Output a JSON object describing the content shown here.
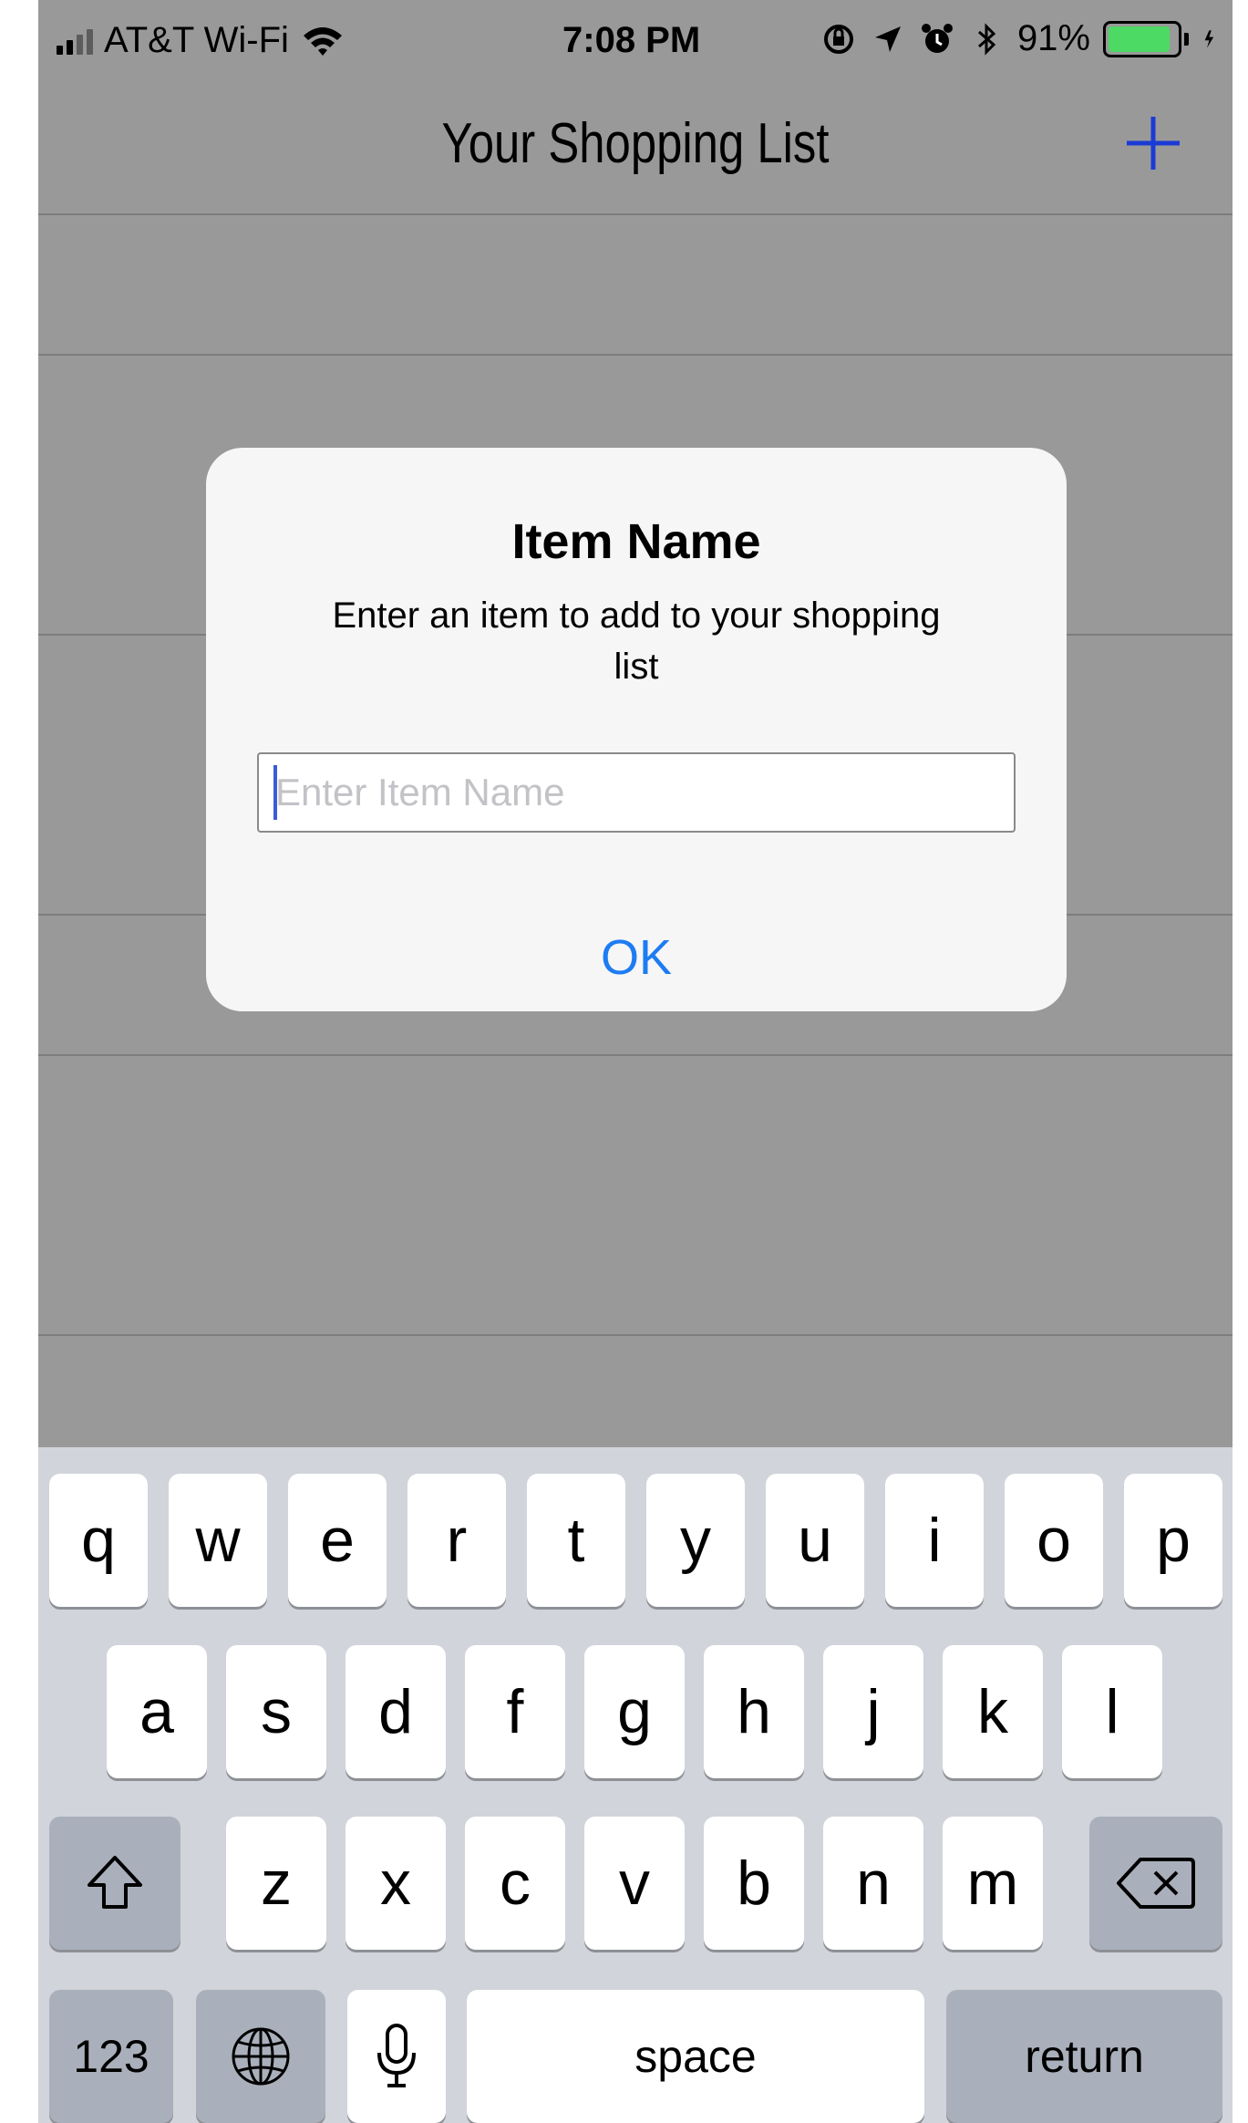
{
  "status_bar": {
    "carrier": "AT&T Wi-Fi",
    "time": "7:08 PM",
    "battery_percent": "91%",
    "battery_level": 0.91,
    "icons": [
      "signal-icon",
      "wifi-icon",
      "orientation-lock-icon",
      "location-icon",
      "alarm-icon",
      "bluetooth-icon",
      "battery-icon",
      "charging-icon"
    ],
    "battery_color": "#4cd964"
  },
  "navbar": {
    "title": "Your Shopping List",
    "add_icon": "plus-icon",
    "accent": "#1a3bd4"
  },
  "alert": {
    "title": "Item Name",
    "message": "Enter an item to add to your shopping list",
    "input_placeholder": "Enter Item Name",
    "input_value": "",
    "ok_label": "OK",
    "ok_color": "#1e7cf2"
  },
  "keyboard": {
    "row1": [
      "q",
      "w",
      "e",
      "r",
      "t",
      "y",
      "u",
      "i",
      "o",
      "p"
    ],
    "row2": [
      "a",
      "s",
      "d",
      "f",
      "g",
      "h",
      "j",
      "k",
      "l"
    ],
    "row3": [
      "z",
      "x",
      "c",
      "v",
      "b",
      "n",
      "m"
    ],
    "shift_icon": "shift-icon",
    "delete_icon": "delete-icon",
    "numbers_label": "123",
    "globe_icon": "globe-icon",
    "mic_icon": "microphone-icon",
    "space_label": "space",
    "return_label": "return"
  }
}
